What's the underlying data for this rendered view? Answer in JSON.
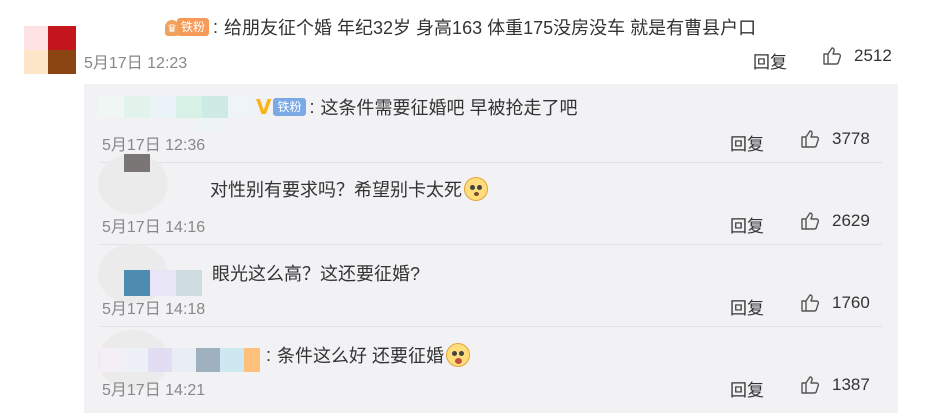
{
  "main_comment": {
    "fan_badge_label": "铁粉",
    "fan_badge_icon": "crown-badge-icon",
    "colon": ":",
    "text": "给朋友征个婚 年纪32岁 身高163 体重175没房没车 就是有曹县户口",
    "time": "5月17日 12:23",
    "reply_label": "回复",
    "likes": "2512"
  },
  "replies": [
    {
      "badge_label": "铁粉",
      "verified_icon": "v-verified-icon",
      "colon": ":",
      "text": "这条件需要征婚吧 早被抢走了吧",
      "time": "5月17日 12:36",
      "reply_label": "回复",
      "likes": "3778"
    },
    {
      "text": "对性别有要求吗？希望别卡太死",
      "emoji": "dog-face-emoji-icon",
      "time": "5月17日 14:16",
      "reply_label": "回复",
      "likes": "2629"
    },
    {
      "text": "眼光这么高？这还要征婚?",
      "time": "5月17日 14:18",
      "reply_label": "回复",
      "likes": "1760"
    },
    {
      "colon": ":",
      "text": "条件这么好  还要征婚",
      "emoji": "surprised-face-emoji-icon",
      "time": "5月17日 14:21",
      "reply_label": "回复",
      "likes": "1387"
    }
  ],
  "colors": {
    "reply_background": "#f2f2f5",
    "meta_text": "#888888",
    "fan_badge_orange": "#f79a57",
    "fan_badge_blue": "#7aa9e6",
    "verified_gold": "#f8b418"
  }
}
